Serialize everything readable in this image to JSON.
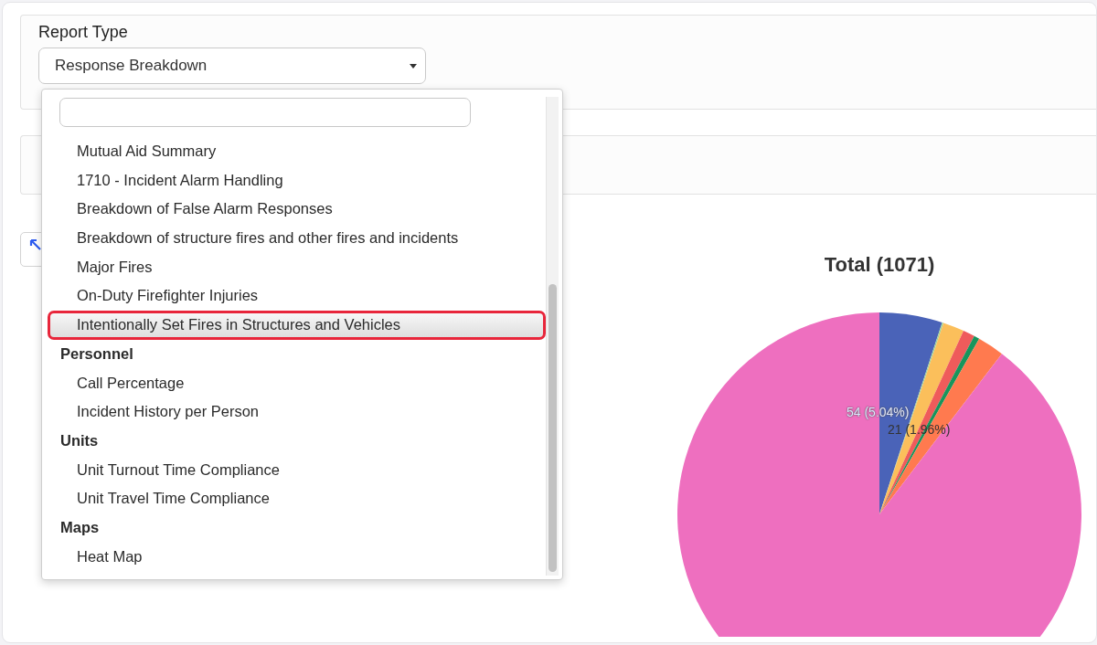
{
  "report_type": {
    "label": "Report Type",
    "value": "Response Breakdown"
  },
  "dropdown": {
    "items": [
      {
        "kind": "option",
        "label": "Mutual Aid Summary",
        "selected": false
      },
      {
        "kind": "option",
        "label": "1710 - Incident Alarm Handling",
        "selected": false
      },
      {
        "kind": "option",
        "label": "Breakdown of False Alarm Responses",
        "selected": false
      },
      {
        "kind": "option",
        "label": "Breakdown of structure fires and other fires and incidents",
        "selected": false
      },
      {
        "kind": "option",
        "label": "Major Fires",
        "selected": false
      },
      {
        "kind": "option",
        "label": "On-Duty Firefighter Injuries",
        "selected": false
      },
      {
        "kind": "option",
        "label": "Intentionally Set Fires in Structures and Vehicles",
        "selected": true
      },
      {
        "kind": "group",
        "label": "Personnel"
      },
      {
        "kind": "option",
        "label": "Call Percentage",
        "selected": false
      },
      {
        "kind": "option",
        "label": "Incident History per Person",
        "selected": false
      },
      {
        "kind": "group",
        "label": "Units"
      },
      {
        "kind": "option",
        "label": "Unit Turnout Time Compliance",
        "selected": false
      },
      {
        "kind": "option",
        "label": "Unit Travel Time Compliance",
        "selected": false
      },
      {
        "kind": "group",
        "label": "Maps"
      },
      {
        "kind": "option",
        "label": "Heat Map",
        "selected": false
      }
    ]
  },
  "chart": {
    "title": "Total (1071)",
    "labels": [
      {
        "kind": "light",
        "text": "54 (5.04%)"
      },
      {
        "kind": "dark",
        "text": "21 (1.96%)"
      }
    ]
  }
}
